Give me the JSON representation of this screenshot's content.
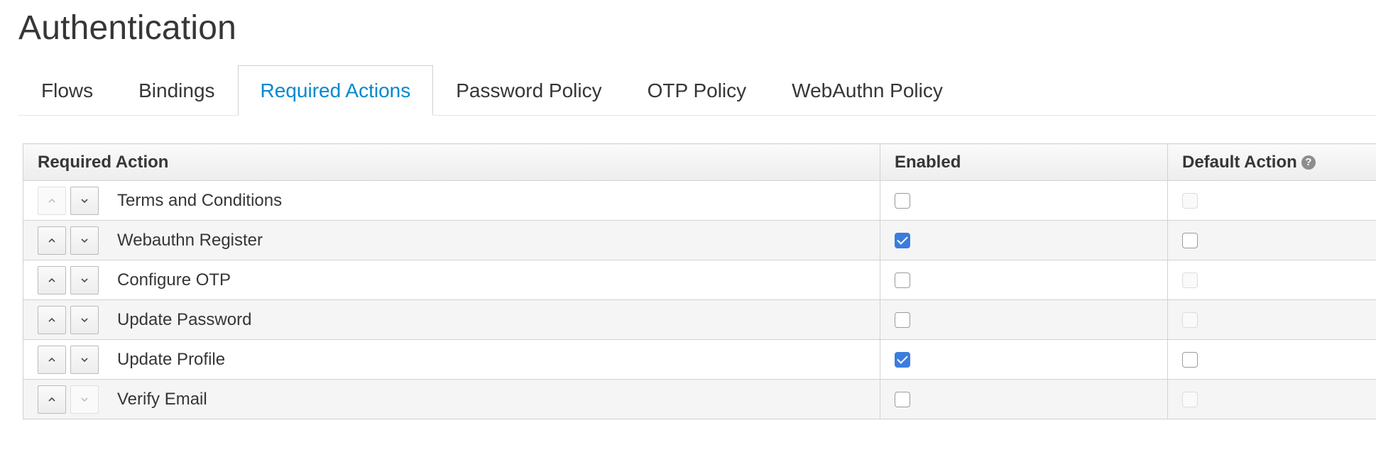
{
  "page": {
    "title": "Authentication"
  },
  "tabs": [
    {
      "label": "Flows",
      "active": false
    },
    {
      "label": "Bindings",
      "active": false
    },
    {
      "label": "Required Actions",
      "active": true
    },
    {
      "label": "Password Policy",
      "active": false
    },
    {
      "label": "OTP Policy",
      "active": false
    },
    {
      "label": "WebAuthn Policy",
      "active": false
    }
  ],
  "table": {
    "headers": {
      "action": "Required Action",
      "enabled": "Enabled",
      "default": "Default Action"
    },
    "rows": [
      {
        "name": "Terms and Conditions",
        "enabled": false,
        "default": false,
        "default_disabled": true,
        "up_disabled": true,
        "down_disabled": false
      },
      {
        "name": "Webauthn Register",
        "enabled": true,
        "default": false,
        "default_disabled": false,
        "up_disabled": false,
        "down_disabled": false
      },
      {
        "name": "Configure OTP",
        "enabled": false,
        "default": false,
        "default_disabled": true,
        "up_disabled": false,
        "down_disabled": false
      },
      {
        "name": "Update Password",
        "enabled": false,
        "default": false,
        "default_disabled": true,
        "up_disabled": false,
        "down_disabled": false
      },
      {
        "name": "Update Profile",
        "enabled": true,
        "default": false,
        "default_disabled": false,
        "up_disabled": false,
        "down_disabled": false
      },
      {
        "name": "Verify Email",
        "enabled": false,
        "default": false,
        "default_disabled": true,
        "up_disabled": false,
        "down_disabled": true
      }
    ]
  },
  "colors": {
    "accent": "#0088ce",
    "checkbox_checked": "#3b7ddd"
  },
  "icons": {
    "help": "question-circle-icon",
    "up": "chevron-up-icon",
    "down": "chevron-down-icon"
  }
}
